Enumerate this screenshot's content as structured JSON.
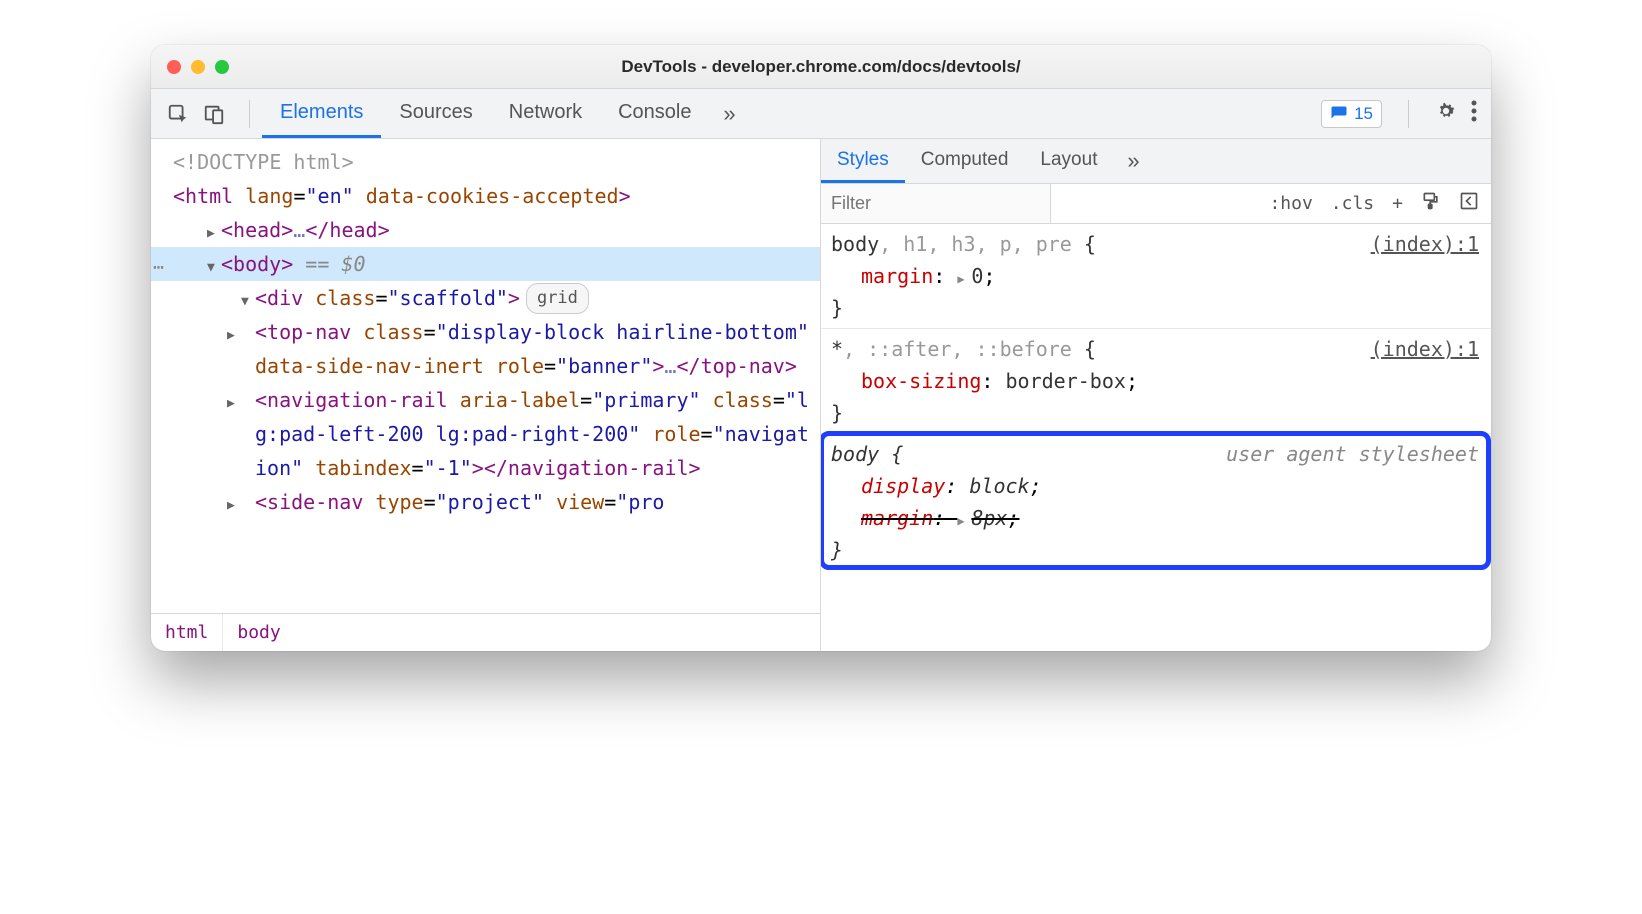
{
  "window": {
    "title": "DevTools - developer.chrome.com/docs/devtools/"
  },
  "toolbar": {
    "tabs": [
      "Elements",
      "Sources",
      "Network",
      "Console"
    ],
    "active_tab": "Elements",
    "issues_count": "15"
  },
  "dom": {
    "doctype": "<!DOCTYPE html>",
    "html_open": {
      "tag": "html",
      "attrs": "lang=\"en\" data-cookies-accepted"
    },
    "head": {
      "tag": "head",
      "ellipsis": "…"
    },
    "body": {
      "tag": "body",
      "suffix": " == $0"
    },
    "scaffold": {
      "open": "<div class=\"scaffold\">",
      "chip": "grid"
    },
    "topnav": {
      "text": "<top-nav class=\"display-block hairline-bottom\" data-side-nav-inert role=\"banner\">…</top-nav>"
    },
    "navrail": {
      "text": "<navigation-rail aria-label=\"primary\" class=\"lg:pad-left-200 lg:pad-right-200\" role=\"navigation\" tabindex=\"-1\"></navigation-rail>"
    },
    "sidenav": {
      "text": "<side-nav type=\"project\" view=\"pro"
    }
  },
  "breadcrumbs": [
    "html",
    "body"
  ],
  "styles_panel": {
    "tabs": [
      "Styles",
      "Computed",
      "Layout"
    ],
    "active_tab": "Styles",
    "filter_placeholder": "Filter",
    "tools": {
      "hov": ":hov",
      "cls": ".cls",
      "plus": "+"
    }
  },
  "rules": [
    {
      "selector_html": "body<span class=\"dim\">, h1, h3, p, pre</span> {",
      "source": "(index):1",
      "props": [
        {
          "name": "margin",
          "value": "0",
          "shorthand": true
        }
      ],
      "close": "}"
    },
    {
      "selector_html": "*<span class=\"dim\">, ::after, ::before</span> {",
      "source": "(index):1",
      "props": [
        {
          "name": "box-sizing",
          "value": "border-box"
        }
      ],
      "close": "}"
    },
    {
      "selector_html": "body {",
      "source_label": "user agent stylesheet",
      "italic": true,
      "props": [
        {
          "name": "display",
          "value": "block"
        },
        {
          "name": "margin",
          "value": "8px",
          "shorthand": true,
          "strike": true
        }
      ],
      "close": "}",
      "highlighted": true
    }
  ]
}
